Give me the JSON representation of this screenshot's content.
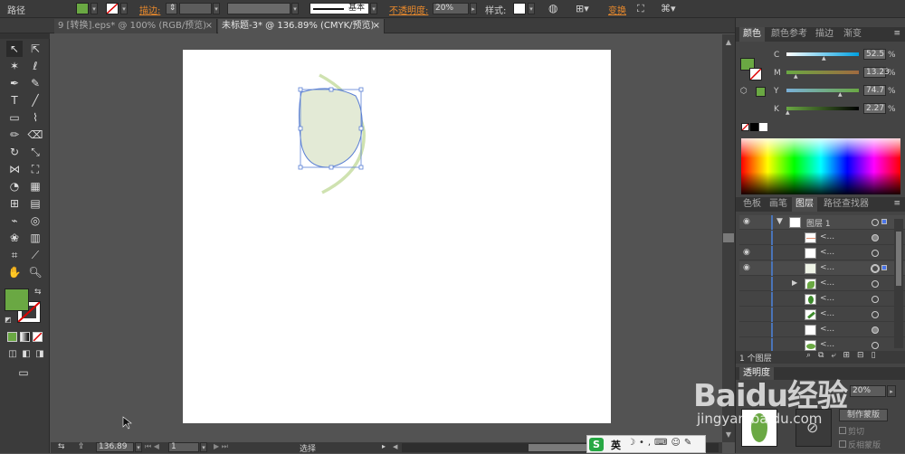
{
  "control_bar": {
    "selection_label": "路径",
    "stroke_label": "描边",
    "stroke_style": "基本",
    "opacity_label": "不透明度",
    "opacity_value": "20%",
    "style_label": "样式",
    "transform_label": "变换"
  },
  "tabs": [
    {
      "label": "9 [转换].eps* @ 100% (RGB/预览)"
    },
    {
      "label": "未标题-3* @ 136.89% (CMYK/预览)"
    }
  ],
  "colors": {
    "fill": "#6aa843",
    "shape_fill": "#e3ead6",
    "shape_stroke": "#5a7fd4",
    "curve": "#cfe2b0"
  },
  "color_panel": {
    "tabs": [
      "颜色",
      "颜色参考",
      "描边",
      "渐变"
    ],
    "C": {
      "label": "C",
      "value": "52.5"
    },
    "M": {
      "label": "M",
      "value": "13.23"
    },
    "Y": {
      "label": "Y",
      "value": "74.7"
    },
    "K": {
      "label": "K",
      "value": "2.27"
    },
    "percent": "%"
  },
  "layers_panel": {
    "tabs": [
      "色板",
      "画笔",
      "图层",
      "路径查找器"
    ],
    "layer_name": "图层 1",
    "sublayer_name": "<...",
    "footer_text": "1 个图层"
  },
  "transparency_panel": {
    "title": "透明度",
    "opacity": "20%",
    "make_mask": "制作蒙版",
    "clip": "剪切",
    "invert_mask": "反相蒙版"
  },
  "status_bar": {
    "zoom": "136.89",
    "page": "1",
    "tool": "选择"
  },
  "ime_bar": {
    "lang": "英"
  },
  "watermark": {
    "brand": "Baidu经验",
    "url": "jingyan.baidu.com"
  }
}
